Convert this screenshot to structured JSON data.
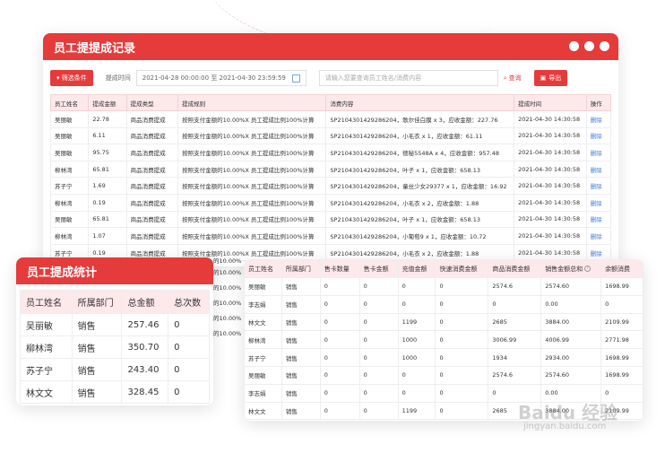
{
  "main": {
    "title": "员工提提成记录",
    "filter_label": "▾ 筛选条件",
    "time_label": "提成时间",
    "date_range": "2021-04-28 00:00:00 至 2021-04-30 23:59:59",
    "search_placeholder": "请输入您要查询员工姓名/消费内容",
    "query_label": "查询",
    "export_label": "导出",
    "columns": [
      "员工姓名",
      "提成金额",
      "提成类型",
      "提成规则",
      "消费内容",
      "提成时间",
      "操作"
    ],
    "rows": [
      [
        "吴丽敏",
        "22.78",
        "商品消费提成",
        "按照支付金额的10.00%X 员工提成比例100%计算",
        "SP2104301429286204，歌尔佳白膜 x 3，应收金额：227.76",
        "2021-04-30 14:30:58",
        "删除"
      ],
      [
        "吴丽敏",
        "6.11",
        "商品消费提成",
        "按照支付金额的10.00%X 员工提成比例100%计算",
        "SP2104301429286204，小毛衣 x 1，应收金额：61.11",
        "2021-04-30 14:30:58",
        "删除"
      ],
      [
        "吴丽敏",
        "95.75",
        "商品消费提成",
        "按照支付金额的10.00%X 员工提成比例100%计算",
        "SP2104301429286204，德秘5548A x 4，应收金额：957.48",
        "2021-04-30 14:30:58",
        "删除"
      ],
      [
        "柳林湾",
        "65.81",
        "商品消费提成",
        "按照支付金额的10.00%X 员工提成比例100%计算",
        "SP2104301429286204，叶子 x 1，应收金额：658.13",
        "2021-04-30 14:30:58",
        "删除"
      ],
      [
        "苏子宁",
        "1.69",
        "商品消费提成",
        "按照支付金额的10.00%X 员工提成比例100%计算",
        "SP2104301429286204，童丝少女29377 x 1，应收金额：16.92",
        "2021-04-30 14:30:58",
        "删除"
      ],
      [
        "柳林湾",
        "0.19",
        "商品消费提成",
        "按照支付金额的10.00%X 员工提成比例100%计算",
        "SP2104301429286204，小毛衣 x 2，应收金额：1.88",
        "2021-04-30 14:30:58",
        "删除"
      ],
      [
        "吴丽敏",
        "65.81",
        "商品消费提成",
        "按照支付金额的10.00%X 员工提成比例100%计算",
        "SP2104301429286204，叶子 x 1，应收金额：658.13",
        "2021-04-30 14:30:58",
        "删除"
      ],
      [
        "柳林湾",
        "1.07",
        "商品消费提成",
        "按照支付金额的10.00%X 员工提成比例100%计算",
        "SP2104301429286204，小葡萄9 x 1，应收金额：10.72",
        "2021-04-30 14:30:58",
        "删除"
      ],
      [
        "苏子宁",
        "0.19",
        "商品消费提成",
        "按照支付金额的10.00%X 员工提成比例100%计算",
        "SP2104301429286204，小毛衣 x 2，应收金额：1.88",
        "2021-04-30 14:30:58",
        "删除"
      ]
    ],
    "hidden_rule_fragments": [
      "的10.00%",
      "的10.00%",
      "的10.00%",
      "的10.00%",
      "的10.00%",
      "的10.00%"
    ]
  },
  "stats": {
    "title": "员工提成统计",
    "columns": [
      "员工姓名",
      "所属部门",
      "总金额",
      "总次数"
    ],
    "rows": [
      [
        "吴丽敏",
        "销售",
        "257.46",
        "0"
      ],
      [
        "柳林湾",
        "销售",
        "350.70",
        "0"
      ],
      [
        "苏子宁",
        "销售",
        "243.40",
        "0"
      ],
      [
        "林文文",
        "销售",
        "328.45",
        "0"
      ]
    ]
  },
  "summary": {
    "columns": [
      "员工姓名",
      "所属部门",
      "售卡数量",
      "售卡金额",
      "充值金额",
      "快速消费金额",
      "商品消费金额",
      "销售金额总和",
      "余额消费"
    ],
    "rows": [
      [
        "吴丽敏",
        "销售",
        "0",
        "0",
        "0",
        "0",
        "2574.6",
        "2574.60",
        "1698.99"
      ],
      [
        "李志娟",
        "销售",
        "0",
        "0",
        "0",
        "0",
        "0",
        "0.00",
        "0"
      ],
      [
        "林文文",
        "销售",
        "0",
        "0",
        "1199",
        "0",
        "2685",
        "3884.00",
        "2109.99"
      ],
      [
        "柳林湾",
        "销售",
        "0",
        "0",
        "1000",
        "0",
        "3006.99",
        "4006.99",
        "2771.98"
      ],
      [
        "苏子宁",
        "销售",
        "0",
        "0",
        "1000",
        "0",
        "1934",
        "2934.00",
        "1698.99"
      ],
      [
        "吴丽敏",
        "销售",
        "0",
        "0",
        "0",
        "0",
        "2574.6",
        "2574.60",
        "1698.99"
      ],
      [
        "李志娟",
        "销售",
        "0",
        "0",
        "0",
        "0",
        "0",
        "0.00",
        "0"
      ],
      [
        "林文文",
        "销售",
        "0",
        "0",
        "1199",
        "0",
        "2685",
        "3884.00",
        "2109.99"
      ]
    ]
  },
  "watermark": {
    "text": "Baidu 经验",
    "sub": "jingyan.baidu.com"
  },
  "colors": {
    "accent": "#e53b3b",
    "header_bg": "#fde8ea",
    "link": "#3b7ddd"
  }
}
